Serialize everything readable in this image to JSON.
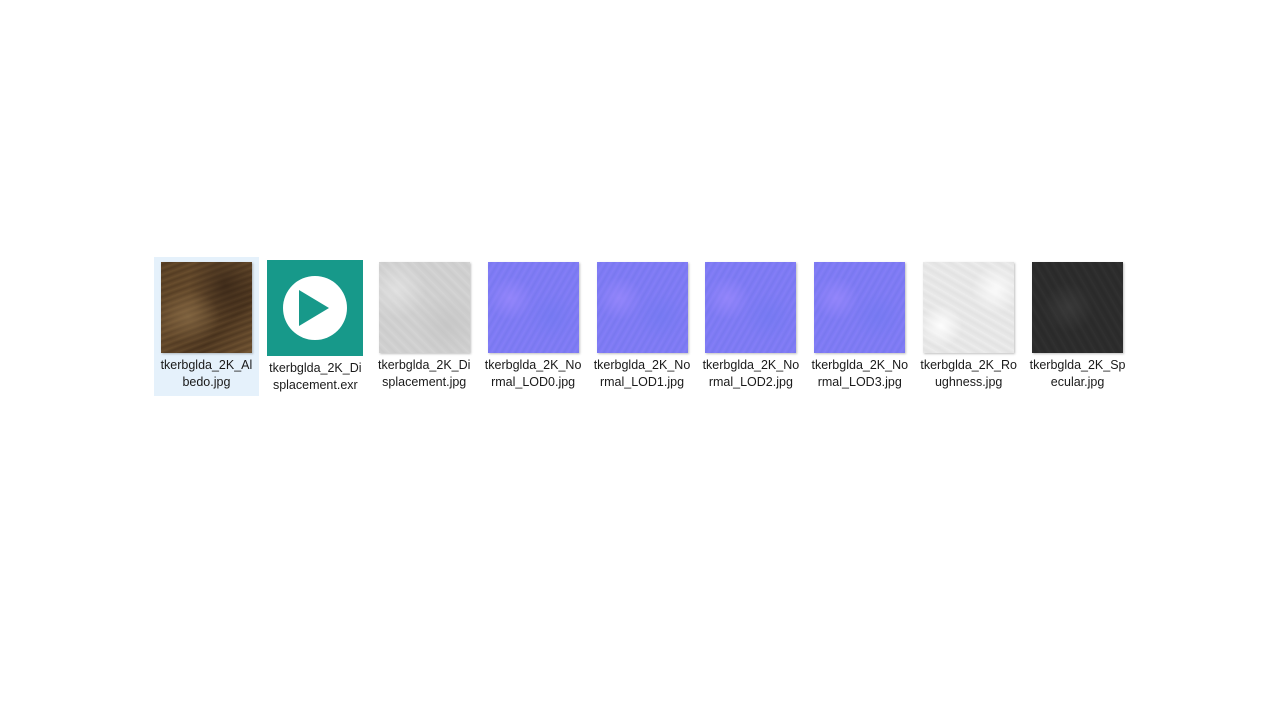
{
  "files": [
    {
      "name": "tkerbglda_2K_Albedo.jpg",
      "selected": true,
      "icon": "image-thumbnail"
    },
    {
      "name": "tkerbglda_2K_Displacement.exr",
      "selected": false,
      "icon": "media-player-icon"
    },
    {
      "name": "tkerbglda_2K_Displacement.jpg",
      "selected": false,
      "icon": "image-thumbnail"
    },
    {
      "name": "tkerbglda_2K_Normal_LOD0.jpg",
      "selected": false,
      "icon": "image-thumbnail"
    },
    {
      "name": "tkerbglda_2K_Normal_LOD1.jpg",
      "selected": false,
      "icon": "image-thumbnail"
    },
    {
      "name": "tkerbglda_2K_Normal_LOD2.jpg",
      "selected": false,
      "icon": "image-thumbnail"
    },
    {
      "name": "tkerbglda_2K_Normal_LOD3.jpg",
      "selected": false,
      "icon": "image-thumbnail"
    },
    {
      "name": "tkerbglda_2K_Roughness.jpg",
      "selected": false,
      "icon": "image-thumbnail"
    },
    {
      "name": "tkerbglda_2K_Specular.jpg",
      "selected": false,
      "icon": "image-thumbnail"
    }
  ],
  "colors": {
    "selection_bg": "#e5f1fb",
    "app_icon_bg": "#17998a",
    "normal_map": "#7f7cf3"
  }
}
